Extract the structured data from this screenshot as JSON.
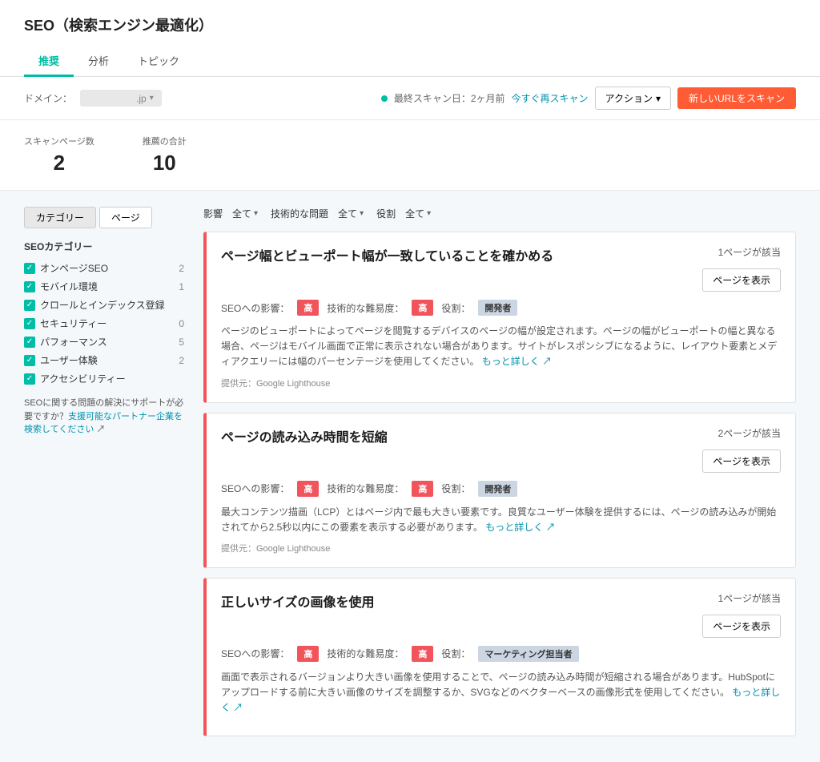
{
  "page": {
    "title": "SEO（検索エンジン最適化）"
  },
  "tabs": [
    {
      "label": "推奨",
      "active": true
    },
    {
      "label": "分析",
      "active": false
    },
    {
      "label": "トピック",
      "active": false
    }
  ],
  "toolbar": {
    "domain_label": "ドメイン：",
    "domain_value": "　　　　　.jp",
    "scan_info": "最終スキャン日：2ヶ月前",
    "rescan_label": "今すぐ再スキャン",
    "action_label": "アクション",
    "scan_button_label": "新しいURLをスキャン"
  },
  "stats": {
    "scanned_label": "スキャンページ数",
    "scanned_value": "2",
    "issues_label": "推薦の合計",
    "issues_value": "10"
  },
  "view_toggle": [
    {
      "label": "カテゴリー",
      "active": true
    },
    {
      "label": "ページ",
      "active": false
    }
  ],
  "sidebar": {
    "title": "SEOカテゴリー",
    "items": [
      {
        "label": "オンページSEO",
        "count": "2",
        "checked": true
      },
      {
        "label": "モバイル環境",
        "count": "1",
        "checked": true
      },
      {
        "label": "クロールとインデックス登録",
        "count": "",
        "checked": true
      },
      {
        "label": "セキュリティー",
        "count": "0",
        "checked": true
      },
      {
        "label": "パフォーマンス",
        "count": "5",
        "checked": true
      },
      {
        "label": "ユーザー体験",
        "count": "2",
        "checked": true
      },
      {
        "label": "アクセシビリティー",
        "count": "",
        "checked": true
      }
    ],
    "partner_note": "SEOに関する問題の解決にサポートが必要ですか？支援可能なパートナー企業を検索してください"
  },
  "filters": [
    {
      "label": "影響　全て"
    },
    {
      "label": "技術的な問題　全て"
    },
    {
      "label": "役割　全て"
    }
  ],
  "issues": [
    {
      "title": "ページ幅とビューポート幅が一致していることを確かめる",
      "page_count": "1ページが該当",
      "show_page_label": "ページを表示",
      "impact_label": "SEOへの影響：",
      "impact_value": "高",
      "difficulty_label": "技術的な難易度：",
      "difficulty_value": "高",
      "role_label": "役割：",
      "role_value": "開発者",
      "description": "ページのビューポートによってページを閲覧するデバイスのページの幅が設定されます。ページの幅がビューポートの幅と異なる場合、ページはモバイル画面で正常に表示されない場合があります。サイトがレスポンシブになるように、レイアウト要素とメディアクエリーには幅のパーセンテージを使用してください。",
      "read_more": "もっと詳しく",
      "source": "提供元：Google Lighthouse"
    },
    {
      "title": "ページの読み込み時間を短縮",
      "page_count": "2ページが該当",
      "show_page_label": "ページを表示",
      "impact_label": "SEOへの影響：",
      "impact_value": "高",
      "difficulty_label": "技術的な難易度：",
      "difficulty_value": "高",
      "role_label": "役割：",
      "role_value": "開発者",
      "description": "最大コンテンツ描画（LCP）とはページ内で最も大きい要素です。良質なユーザー体験を提供するには、ページの読み込みが開始されてから2.5秒以内にこの要素を表示する必要があります。",
      "read_more": "もっと詳しく",
      "source": "提供元：Google Lighthouse"
    },
    {
      "title": "正しいサイズの画像を使用",
      "page_count": "1ページが該当",
      "show_page_label": "ページを表示",
      "impact_label": "SEOへの影響：",
      "impact_value": "高",
      "difficulty_label": "技術的な難易度：",
      "difficulty_value": "高",
      "role_label": "役割：",
      "role_value": "マーケティング担当者",
      "description": "画面で表示されるバージョンより大きい画像を使用することで、ページの読み込み時間が短縮される場合があります。HubSpotにアップロードする前に大きい画像のサイズを調整するか、SVGなどのベクターベースの画像形式を使用してください。",
      "read_more": "もっと詳しく",
      "source": ""
    }
  ]
}
